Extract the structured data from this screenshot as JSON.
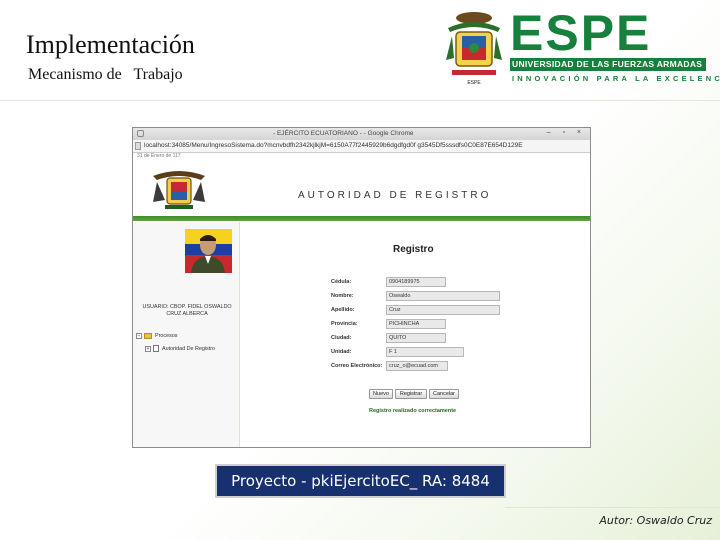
{
  "slide": {
    "title": "Implementación",
    "subtitle": "Mecanismo de   Trabajo",
    "caption": "Proyecto - pkiEjercitoEC_ RA: 8484",
    "author": "Autor: Oswaldo Cruz"
  },
  "logo": {
    "wordmark": "ESPE",
    "university": "UNIVERSIDAD DE LAS FUERZAS ARMADAS",
    "motto": "INNOVACIÓN PARA LA EXCELENCIA",
    "brand_color": "#17803c"
  },
  "browser": {
    "window_title": "- EJÉRCITO ECUATORIANO - - Google Chrome",
    "window_controls": "– ▫ ×",
    "url": "localhost:34085/Menu/IngresoSistema.do?mcnvbdfh2342kjlkjM=6150A77f2445929b6dgdfgd0f g3545Df5sssdfs0C0E87E654D129E",
    "tab_strip": "31 de Enero de 117"
  },
  "app": {
    "header_title": "AUTORIDAD DE REGISTRO",
    "user_label": "USUARIO: CBOP.  FIDEL OSWALDO CRUZ ALBERCA",
    "tree": [
      {
        "toggle": "−",
        "label": "Procesos"
      },
      {
        "toggle": "+",
        "label": "Autoridad De Registro"
      }
    ],
    "form": {
      "title": "Registro",
      "fields": [
        {
          "label": "Cédula:",
          "value": "0904189975"
        },
        {
          "label": "Nombre:",
          "value": "Oswaldo"
        },
        {
          "label": "Apellido:",
          "value": "Cruz"
        },
        {
          "label": "Provincia:",
          "value": "PICHINCHA"
        },
        {
          "label": "Ciudad:",
          "value": "QUITO"
        },
        {
          "label": "Unidad:",
          "value": "F 1"
        },
        {
          "label": "Correo Electrónico:",
          "value": "cruz_o@ecuad.com"
        }
      ],
      "buttons": {
        "new": "Nuevo",
        "register": "Registrar",
        "cancel": "Cancelar"
      },
      "status": "Registro realizado correctamente"
    }
  },
  "colors": {
    "header_rule": "#4a9438",
    "caption_bg": "#17306f",
    "status_text": "#1f6f1f"
  }
}
